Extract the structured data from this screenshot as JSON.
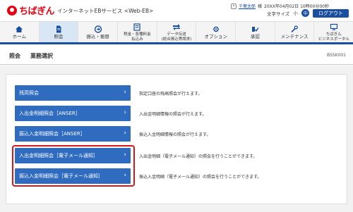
{
  "header": {
    "logo_text": "ちばぎん",
    "service_name": "インターネットEBサービス <Web-EB>",
    "user_name": "千葉太郎",
    "user_suffix": "様",
    "datetime": "20XX年04月02日 10時00分00秒",
    "font_size_label": "文字サイズ",
    "size_small": "小",
    "size_medium": "中",
    "size_large": "大",
    "logout_label": "ログアウト"
  },
  "nav": {
    "items": [
      {
        "label": "ホーム",
        "icon": "home-icon"
      },
      {
        "label": "照会",
        "icon": "document-icon"
      },
      {
        "label": "振込・振替",
        "icon": "transfer-icon"
      },
      {
        "label": "税金・各種料金\n払込み",
        "icon": "tax-icon"
      },
      {
        "label": "データ伝送\n(総合振込等請求)",
        "icon": "data-icon"
      },
      {
        "label": "オプション",
        "icon": "option-icon"
      },
      {
        "label": "承認",
        "icon": "approve-icon"
      },
      {
        "label": "メンテナンス",
        "icon": "maintenance-icon"
      },
      {
        "label": "ちばぎん\nビジネスポータル",
        "icon": "portal-icon"
      }
    ],
    "active_index": 1
  },
  "page": {
    "title": "照会",
    "subtitle": "業務選択",
    "screen_id": "BSSK001"
  },
  "menu": {
    "items": [
      {
        "label": "残高照会",
        "description": "指定口座の残高照会が行えます。"
      },
      {
        "label": "入出金明細照会［ANSER］",
        "description": "入出金明細情報の照会が行えます。"
      },
      {
        "label": "振込入金明細照会［ANSER］",
        "description": "振込入金明細情報の照会が行えます。"
      },
      {
        "label": "入出金明細照会［電子メール通知］",
        "description": "入出金明細（電子メール通知）の照会を行うことができます。"
      },
      {
        "label": "振込入金明細照会［電子メール通知］",
        "description": "振込入金明細（電子メール通知）の照会を行うことができます。"
      }
    ]
  },
  "colors": {
    "brand_red": "#e60012",
    "primary_blue": "#1a4e9f",
    "button_blue": "#2f6cc0",
    "highlight_red": "#d9161c"
  }
}
